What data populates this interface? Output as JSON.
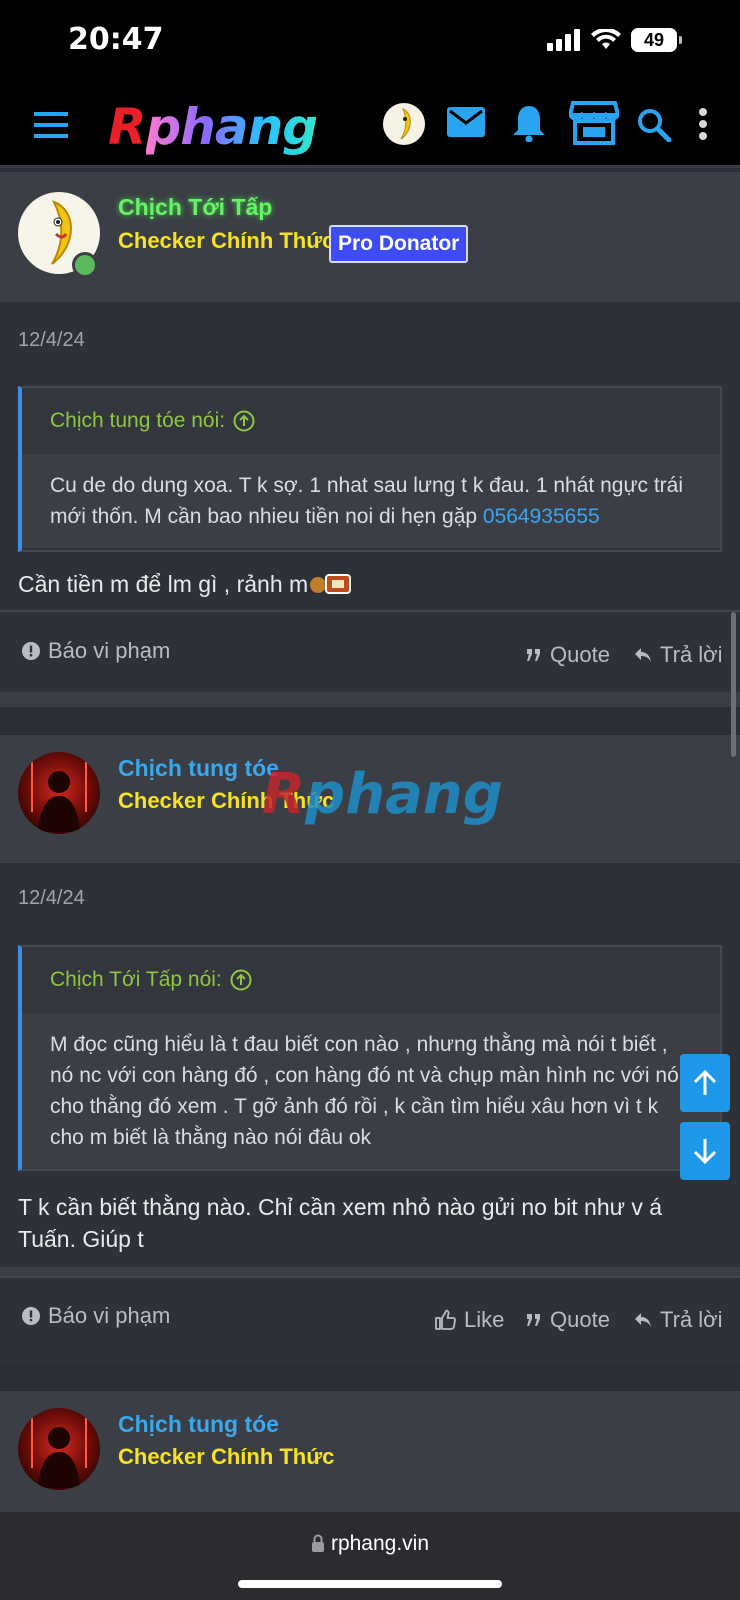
{
  "status": {
    "time": "20:47",
    "battery": "49"
  },
  "header": {
    "logo_r": "R",
    "logo_rest": "phang"
  },
  "posts": [
    {
      "author": "Chịch Tới Tấp",
      "author_color": "#6bf06b",
      "title": "Checker Chính Thức",
      "badge": "Pro Donator",
      "date": "12/4/24",
      "quote_author": "Chịch tung tóe nói:",
      "quote_text": "Cu de do dung xoa. T k sợ. 1 nhat sau lưng t k đau. 1 nhát ngực trái mới thốn. M cần bao nhieu tiền noi di hẹn gặp ",
      "quote_link": "0564935655",
      "message": "Cần tiền m để lm gì , rảnh m",
      "report": "Báo vi phạm",
      "quote_btn": "Quote",
      "reply": "Trả lời"
    },
    {
      "author": "Chịch tung tóe",
      "author_color": "#3aa8ee",
      "title": "Checker Chính Thức",
      "date": "12/4/24",
      "quote_author": "Chịch Tới Tấp nói:",
      "quote_text": "M đọc cũng hiểu là t đau biết con nào , nhưng thằng mà nói t biết , nó nc với con hàng đó , con hàng đó nt và chụp màn hình nc với nó cho thằng đó xem . T gỡ ảnh đó rồi , k cần tìm hiểu xâu hơn vì t k cho m biết là thằng nào nói đâu ok",
      "message": "T k cần biết thằng nào. Chỉ cần xem nhỏ nào gửi no bit như v á Tuấn. Giúp t",
      "report": "Báo vi phạm",
      "like": "Like",
      "quote_btn": "Quote",
      "reply": "Trả lời"
    },
    {
      "author": "Chịch tung tóe",
      "title": "Checker Chính Thức"
    }
  ],
  "watermark": {
    "r": "R",
    "rest": "phang"
  },
  "browser": {
    "url": "rphang.vin"
  }
}
